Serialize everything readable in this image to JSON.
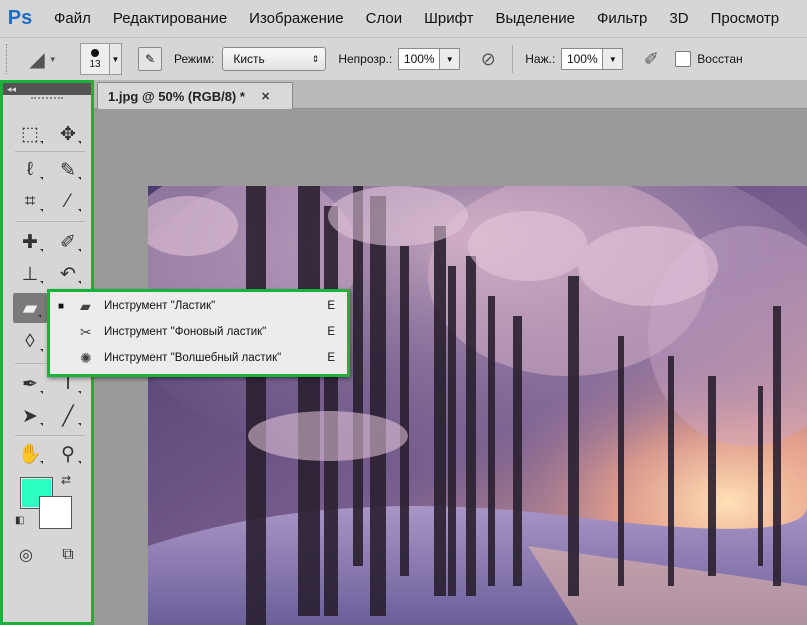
{
  "app": {
    "logo": "Ps"
  },
  "menu": [
    "Файл",
    "Редактирование",
    "Изображение",
    "Слои",
    "Шрифт",
    "Выделение",
    "Фильтр",
    "3D",
    "Просмотр"
  ],
  "options": {
    "brush_size": "13",
    "mode_label": "Режим:",
    "mode_value": "Кисть",
    "opacity_label": "Непрозр.:",
    "opacity_value": "100%",
    "flow_label": "Наж.:",
    "flow_value": "100%",
    "erase_history_label": "Восстан"
  },
  "tools": {
    "header": "◂◂",
    "foreground_color": "#2dffc2",
    "background_color": "#ffffff",
    "active_tool": "eraser-tool"
  },
  "document": {
    "tab_title": "1.jpg @ 50% (RGB/8) *",
    "close_glyph": "✕"
  },
  "flyout": [
    {
      "selected": true,
      "icon": "eraser-icon",
      "label": "Инструмент \"Ластик\"",
      "shortcut": "E"
    },
    {
      "selected": false,
      "icon": "background-eraser-icon",
      "label": "Инструмент \"Фоновый ластик\"",
      "shortcut": "E"
    },
    {
      "selected": false,
      "icon": "magic-eraser-icon",
      "label": "Инструмент \"Волшебный ластик\"",
      "shortcut": "E"
    }
  ],
  "accent_colors": {
    "highlight": "#19b33c",
    "ps_logo": "#1a6fc4"
  }
}
